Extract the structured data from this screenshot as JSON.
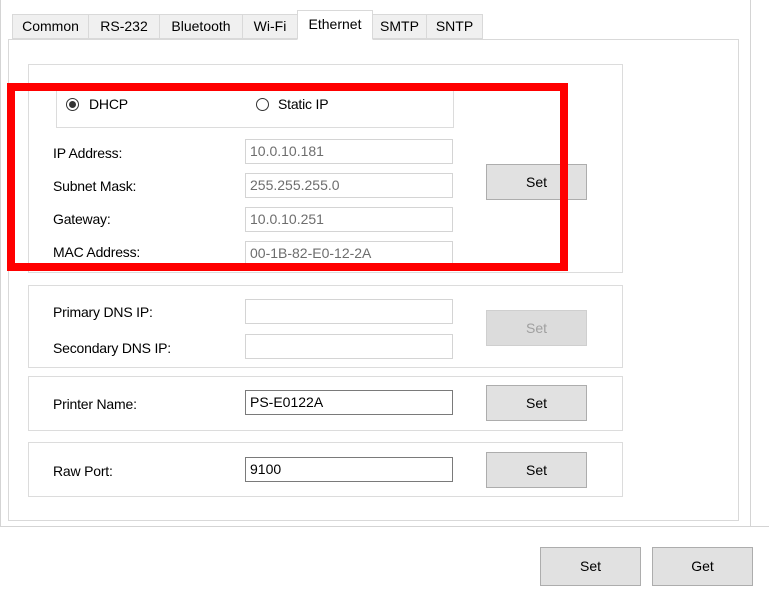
{
  "tabs": [
    "Common",
    "RS-232",
    "Bluetooth",
    "Wi-Fi",
    "Ethernet",
    "SMTP",
    "SNTP"
  ],
  "active_tab": "Ethernet",
  "ip_mode": {
    "options": [
      "DHCP",
      "Static IP"
    ],
    "selected": "DHCP"
  },
  "network": {
    "ip_address_label": "IP Address:",
    "ip_address": "10.0.10.181",
    "subnet_mask_label": "Subnet Mask:",
    "subnet_mask": "255.255.255.0",
    "gateway_label": "Gateway:",
    "gateway": "10.0.10.251",
    "mac_address_label": "MAC Address:",
    "mac_address": "00-1B-82-E0-12-2A",
    "set_label": "Set"
  },
  "dns": {
    "primary_label": "Primary DNS IP:",
    "primary_value": "",
    "secondary_label": "Secondary DNS IP:",
    "secondary_value": "",
    "set_label": "Set"
  },
  "printer": {
    "name_label": "Printer Name:",
    "name_value": "PS-E0122A",
    "set_label": "Set"
  },
  "raw_port": {
    "label": "Raw Port:",
    "value": "9100",
    "set_label": "Set"
  },
  "footer": {
    "set_label": "Set",
    "get_label": "Get"
  },
  "colors": {
    "highlight": "#ff0000",
    "button_bg": "#e1e1e1",
    "border": "#d9d9d9"
  }
}
